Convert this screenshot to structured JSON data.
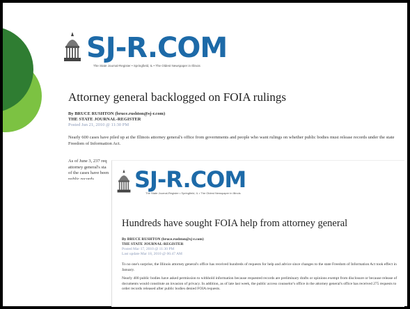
{
  "slide": {
    "background": "#000000",
    "accent_dark_green": "#2f7d32",
    "accent_light_green": "#7cc242"
  },
  "article1": {
    "logo": "SJ-R.COM",
    "tagline": "The State Journal-Register • Springfield, IL • The Oldest Newspaper in Illinois",
    "headline": "Attorney general backlogged on FOIA rulings",
    "byline_author": "By BRUCE RUSHTON (bruce.rushton@sj-r.com)",
    "byline_paper": "THE STATE JOURNAL-REGISTER",
    "posted": "Posted Jun 21, 2010 @ 11:30 PM",
    "paragraph1": "Nearly 600 cases have piled up at the Illinois attorney general's office from governments and people who want rulings on whether public bodies must release records under the state Freedom of Information Act.",
    "paragraph2_lines": [
      "As of June 3, 237 req",
      "attorney general's sta",
      "of the cases have been",
      "public records"
    ]
  },
  "article2": {
    "logo": "SJ-R.COM",
    "tagline": "The State Journal-Register • Springfield, IL • The Oldest Newspaper in Illinois",
    "headline": "Hundreds have sought FOIA help from attorney general",
    "byline_author": "By BRUCE RUSHTON (bruce.rushton@sj-r.com)",
    "byline_paper": "THE STATE JOURNAL-REGISTER",
    "posted": "Posted Mar 17, 2010 @ 11:30 PM",
    "updated": "Last update Mar 18, 2010 @ 06:47 AM",
    "paragraph1": "To no one's surprise, the Illinois attorney general's office has received hundreds of requests for help and advice since changes to the state Freedom of Information Act took effect in January.",
    "paragraph2": "Nearly 400 public bodies have asked permission to withhold information because requested records are preliminary drafts or opinions exempt from disclosure or because release of documents would constitute an invasion of privacy. In addition, as of late last week, the public access counselor's office in the attorney general's office has received 275 requests to order records released after public bodies denied FOIA requests."
  }
}
